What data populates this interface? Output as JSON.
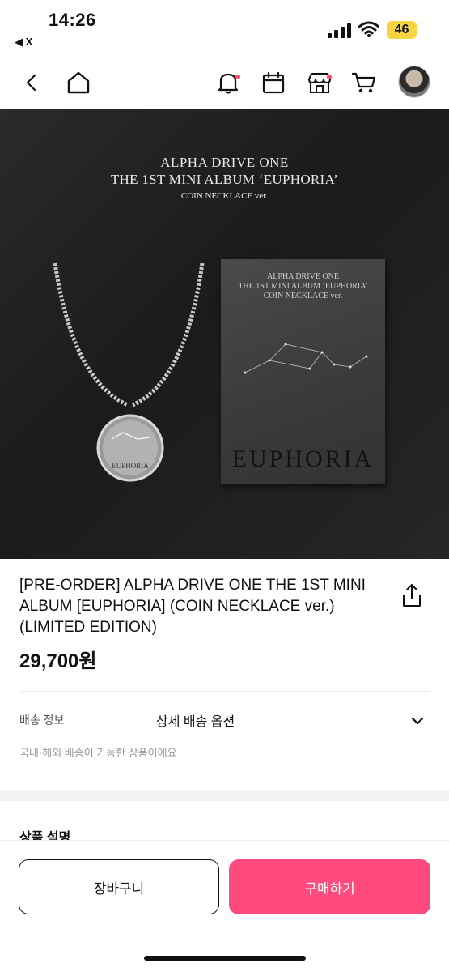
{
  "status_bar": {
    "time": "14:26",
    "back_label": "◀ X",
    "battery": "46"
  },
  "nav": {
    "back_icon": "chevron-left-icon",
    "home_icon": "home-icon",
    "bell_icon": "bell-icon",
    "calendar_icon": "calendar-icon",
    "store_icon": "store-icon",
    "cart_icon": "cart-icon",
    "badge_color": "#ff4b6e"
  },
  "hero": {
    "line1": "ALPHA DRIVE ONE",
    "line2": "THE 1ST MINI ALBUM ‘EUPHORIA’",
    "line3": "COIN NECKLACE ver.",
    "album_line1": "ALPHA DRIVE ONE",
    "album_line2": "THE 1ST MINI ALBUM ‘EUPHORIA’",
    "album_line3": "COIN NECKLACE ver.",
    "album_title": "EUPHORIA",
    "coin_text": "EUPHORIA"
  },
  "product": {
    "title": "[PRE-ORDER] ALPHA DRIVE ONE THE 1ST MINI ALBUM [EUPHORIA] (COIN NECKLACE ver.) (LIMITED EDITION)",
    "price": "29,700원",
    "share_icon": "share-icon"
  },
  "shipping": {
    "label": "배송 정보",
    "option": "상세 배송 옵션",
    "note": "국내·해외 배송이 가능한 상품이에요"
  },
  "description": {
    "title": "상품 설명"
  },
  "actions": {
    "cart_label": "장바구니",
    "buy_label": "구매하기",
    "buy_color": "#ff4a7d"
  }
}
